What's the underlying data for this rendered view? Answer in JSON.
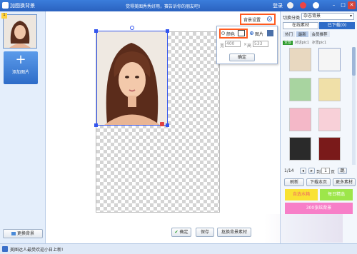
{
  "title": "加图换背景",
  "header_msg": "觉得美图秀秀好用，赛告诉你的朋友吧!",
  "login": "登录",
  "left": {
    "add_photo": "添加图片",
    "replace_bg": "更换背景"
  },
  "bg_settings": {
    "button": "背景设置",
    "color_label": "颜色",
    "image_label": "图片",
    "width_label": "宽",
    "width_value": "400",
    "height_label": "高",
    "height_value": "533",
    "confirm": "确定"
  },
  "canvas": {
    "ok": "确定",
    "save": "保存",
    "save_as_material": "抠换背景素材"
  },
  "right": {
    "category_label": "切换分类",
    "category_value": "杂志背景",
    "tab_online": "在线素材",
    "tab_downloaded": "已下载(0)",
    "subtabs": [
      "热门",
      "最新",
      "会员推荐"
    ],
    "filter_tags": [
      "全部",
      "对话pic1",
      "冰雪pic1"
    ],
    "page": "1/14",
    "page_input": "1",
    "go": "跳",
    "refresh": "刷新",
    "download": "下载本页",
    "more": "更多素材",
    "promo": [
      "自选水箱",
      "每日精选",
      "300张炫背景"
    ]
  },
  "status": {
    "text": "美图达人最受欢迎小日上新!"
  },
  "colors": {
    "titlebar": "#2a62bf",
    "highlight": "#ff5a1f",
    "selection": "#3355ee"
  }
}
